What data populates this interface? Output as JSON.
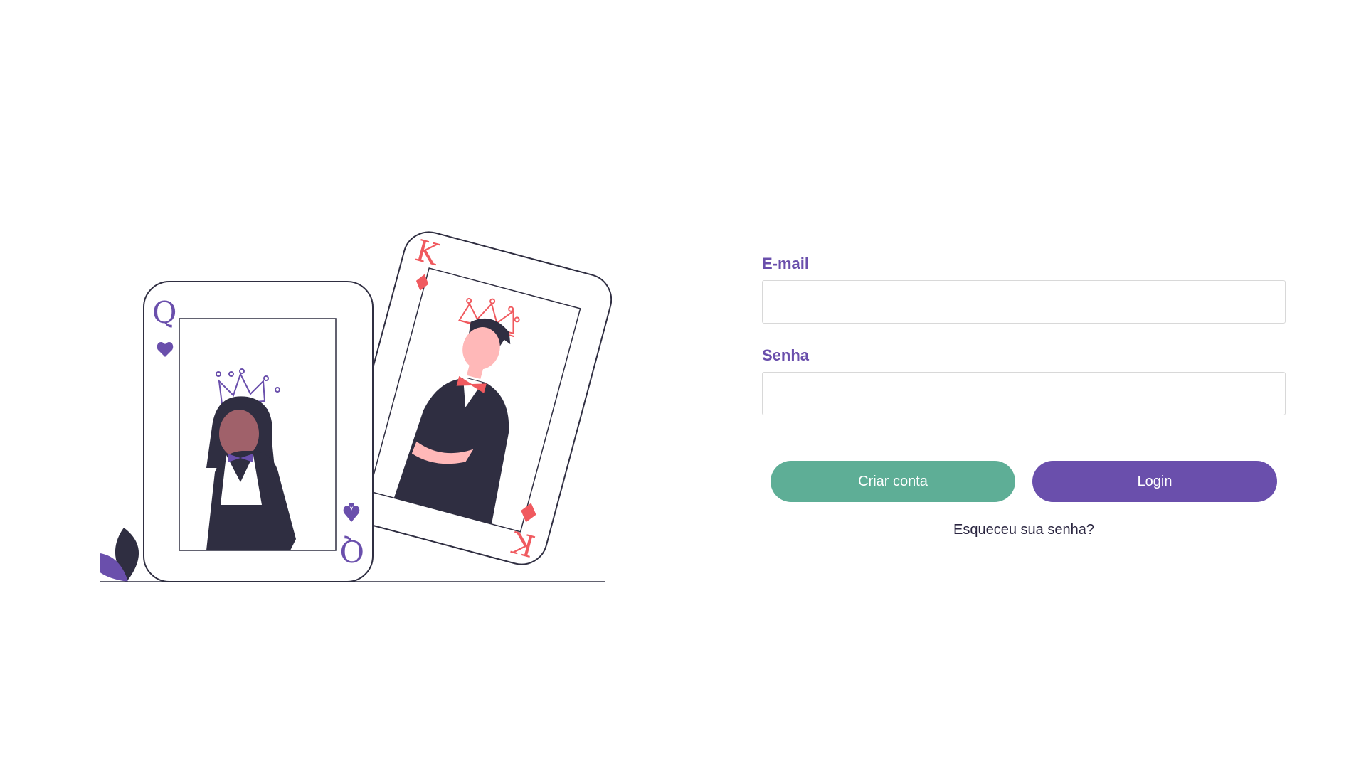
{
  "login_form": {
    "email_label": "E-mail",
    "email_value": "",
    "password_label": "Senha",
    "password_value": "",
    "create_account_label": "Criar conta",
    "login_label": "Login",
    "forgot_password_label": "Esqueceu sua senha?"
  },
  "illustration": {
    "queen_card_letter": "Q",
    "king_card_letter": "K",
    "icons": [
      "heart-icon",
      "spade-icon",
      "diamond-icon",
      "crown-icon",
      "leaf-icon"
    ]
  },
  "colors": {
    "accent_purple": "#6a4fac",
    "accent_green": "#5eae96",
    "accent_red": "#f05a5f",
    "ink": "#2f2e41"
  }
}
